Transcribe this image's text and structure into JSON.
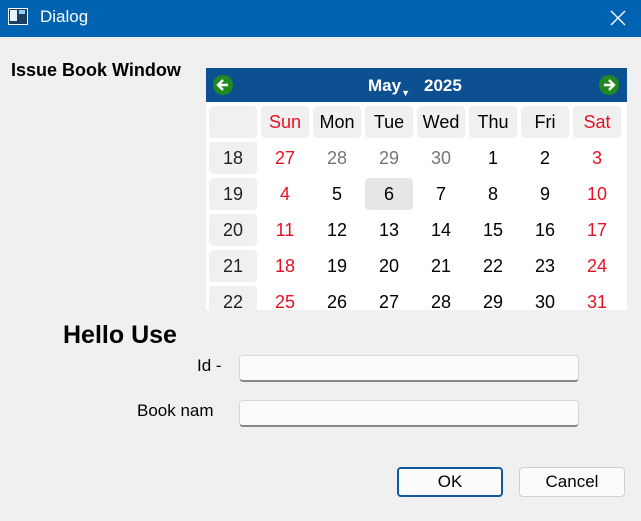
{
  "window": {
    "title": "Dialog"
  },
  "heading": "Issue Book Window",
  "calendar": {
    "month": "May",
    "year": "2025",
    "day_headers": [
      "Sun",
      "Mon",
      "Tue",
      "Wed",
      "Thu",
      "Fri",
      "Sat"
    ],
    "weeks": [
      {
        "week": "18",
        "days": [
          "27",
          "28",
          "29",
          "30",
          "1",
          "2",
          "3"
        ]
      },
      {
        "week": "19",
        "days": [
          "4",
          "5",
          "6",
          "7",
          "8",
          "9",
          "10"
        ]
      },
      {
        "week": "20",
        "days": [
          "11",
          "12",
          "13",
          "14",
          "15",
          "16",
          "17"
        ]
      },
      {
        "week": "21",
        "days": [
          "18",
          "19",
          "20",
          "21",
          "22",
          "23",
          "24"
        ]
      },
      {
        "week": "22",
        "days": [
          "25",
          "26",
          "27",
          "28",
          "29",
          "30",
          "31"
        ]
      }
    ],
    "selected_day": "6",
    "colors": {
      "nav_bg": "#0d5091",
      "weekend": "#e81123",
      "other_month": "#767676",
      "nav_arrow": "#1f8a1f"
    }
  },
  "greeting": "Hello Use",
  "form": {
    "id_label": "Id -",
    "book_label": "Book nam",
    "id_value": "",
    "book_value": ""
  },
  "buttons": {
    "ok": "OK",
    "cancel": "Cancel"
  },
  "colors": {
    "titlebar": "#0063b1",
    "ok_border": "#0f5aa3"
  }
}
